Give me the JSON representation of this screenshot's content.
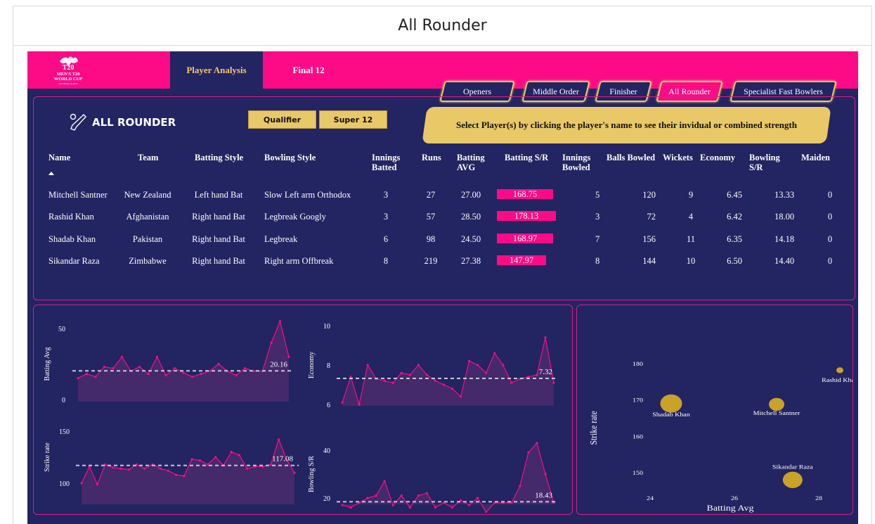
{
  "page": {
    "title": "All Rounder"
  },
  "colors": {
    "navy": "#232462",
    "magenta": "#fd0b86",
    "gold": "#e9c867",
    "bubble": "#c9a227",
    "panel_border": "#d61f86"
  },
  "logo": {
    "lines": [
      "T20",
      "MEN'S T20",
      "WORLD CUP",
      "AUSTRALIA 2022"
    ]
  },
  "nav": {
    "tabs": [
      "Player Analysis",
      "Final 12"
    ],
    "active": "Player Analysis"
  },
  "roles": {
    "items": [
      "Openers",
      "Middle Order",
      "Finisher",
      "All Rounder",
      "Specialist Fast Bowlers"
    ],
    "active": "All Rounder"
  },
  "section": {
    "title": "ALL ROUNDER",
    "icon": "cricket-bat-icon"
  },
  "stages": [
    "Qualifier",
    "Super 12"
  ],
  "hint": "Select Player(s) by clicking the player's name to see their invidual or combined strength",
  "table": {
    "headers": [
      "Name",
      "Team",
      "Batting Style",
      "Bowling Style",
      "Innings Batted",
      "Runs",
      "Batting AVG",
      "Batting S/R",
      "Innings Bowled",
      "Balls Bowled",
      "Wickets",
      "Economy",
      "Bowling S/R",
      "Maiden"
    ],
    "header_lines": [
      [
        "Name"
      ],
      [
        "Team"
      ],
      [
        "Batting Style"
      ],
      [
        "Bowling Style"
      ],
      [
        "Innings",
        "Batted"
      ],
      [
        "Runs"
      ],
      [
        "Batting",
        "AVG"
      ],
      [
        "Batting S/R"
      ],
      [
        "Innings",
        "Bowled"
      ],
      [
        "Balls Bowled"
      ],
      [
        "Wickets"
      ],
      [
        "Economy"
      ],
      [
        "Bowling",
        "S/R"
      ],
      [
        "Maiden"
      ]
    ],
    "rows": [
      [
        "Mitchell Santner",
        "New Zealand",
        "Left hand Bat",
        "Slow Left arm Orthodox",
        "3",
        "27",
        "27.00",
        "168.75",
        "5",
        "120",
        "9",
        "6.45",
        "13.33",
        "0"
      ],
      [
        "Rashid Khan",
        "Afghanistan",
        "Right hand Bat",
        "Legbreak Googly",
        "3",
        "57",
        "28.50",
        "178.13",
        "3",
        "72",
        "4",
        "6.42",
        "18.00",
        "0"
      ],
      [
        "Shadab Khan",
        "Pakistan",
        "Right hand Bat",
        "Legbreak",
        "6",
        "98",
        "24.50",
        "168.97",
        "7",
        "156",
        "11",
        "6.35",
        "14.18",
        "0"
      ],
      [
        "Sikandar Raza",
        "Zimbabwe",
        "Right hand Bat",
        "Right arm Offbreak",
        "8",
        "219",
        "27.38",
        "147.97",
        "8",
        "144",
        "10",
        "6.50",
        "14.40",
        "0"
      ]
    ]
  },
  "chart_data": [
    {
      "type": "area",
      "ylabel": "Batting Avg",
      "y_ticks": [
        "50",
        "0"
      ],
      "ylim": [
        0,
        50
      ],
      "average_line": 20.16,
      "average_label": "20.16",
      "values": [
        15,
        18,
        16,
        23,
        22,
        30,
        20,
        23,
        18,
        30,
        17,
        22,
        19,
        16,
        18,
        20,
        25,
        20,
        17,
        22,
        20,
        20,
        40,
        55,
        30
      ]
    },
    {
      "type": "area",
      "ylabel": "Economy",
      "y_ticks": [
        "10",
        "8",
        "6"
      ],
      "ylim": [
        6,
        10
      ],
      "average_line": 7.32,
      "average_label": "7.32",
      "values": [
        6.1,
        7.4,
        6.0,
        8.0,
        7.3,
        7.2,
        7.1,
        7.6,
        7.5,
        8.0,
        7.5,
        7.2,
        7.0,
        6.8,
        6.4,
        8.2,
        8.0,
        7.6,
        8.6,
        8.0,
        7.1,
        7.3,
        7.4,
        7.5,
        9.4,
        7.1
      ]
    },
    {
      "type": "area",
      "ylabel": "Strike rate",
      "y_ticks": [
        "150",
        "100"
      ],
      "ylim": [
        100,
        150
      ],
      "average_line": 117.08,
      "average_label": "117.08",
      "values": [
        100,
        116,
        99,
        118,
        115,
        114,
        113,
        118,
        114,
        118,
        114,
        112,
        108,
        107,
        123,
        122,
        118,
        125,
        117,
        130,
        127,
        114,
        116,
        116,
        118,
        142,
        123,
        110
      ]
    },
    {
      "type": "area",
      "ylabel": "Bowling S/R",
      "y_ticks": [
        "40",
        "20"
      ],
      "ylim": [
        15,
        45
      ],
      "average_line": 18.43,
      "average_label": "18.43",
      "values": [
        17,
        16,
        18,
        20,
        21,
        27,
        17,
        21,
        16,
        21,
        22,
        16,
        18,
        16,
        19,
        17,
        20,
        14,
        18,
        18,
        18,
        25,
        39,
        43,
        30,
        18
      ]
    },
    {
      "type": "scatter",
      "xlabel": "Batting Avg",
      "ylabel": "Strike rate",
      "x_ticks": [
        "24",
        "26",
        "28"
      ],
      "y_ticks": [
        "180",
        "170",
        "160",
        "150"
      ],
      "xlim": [
        23.5,
        29.5
      ],
      "ylim": [
        145,
        182
      ],
      "points": [
        {
          "label": "Rashid Khan",
          "x": 28.5,
          "y": 178.13,
          "size": 72
        },
        {
          "label": "Shadab Khan",
          "x": 24.5,
          "y": 168.97,
          "size": 156
        },
        {
          "label": "Mitchell Santner",
          "x": 27.0,
          "y": 168.75,
          "size": 120
        },
        {
          "label": "Sikandar Raza",
          "x": 27.38,
          "y": 147.97,
          "size": 144
        }
      ]
    }
  ]
}
